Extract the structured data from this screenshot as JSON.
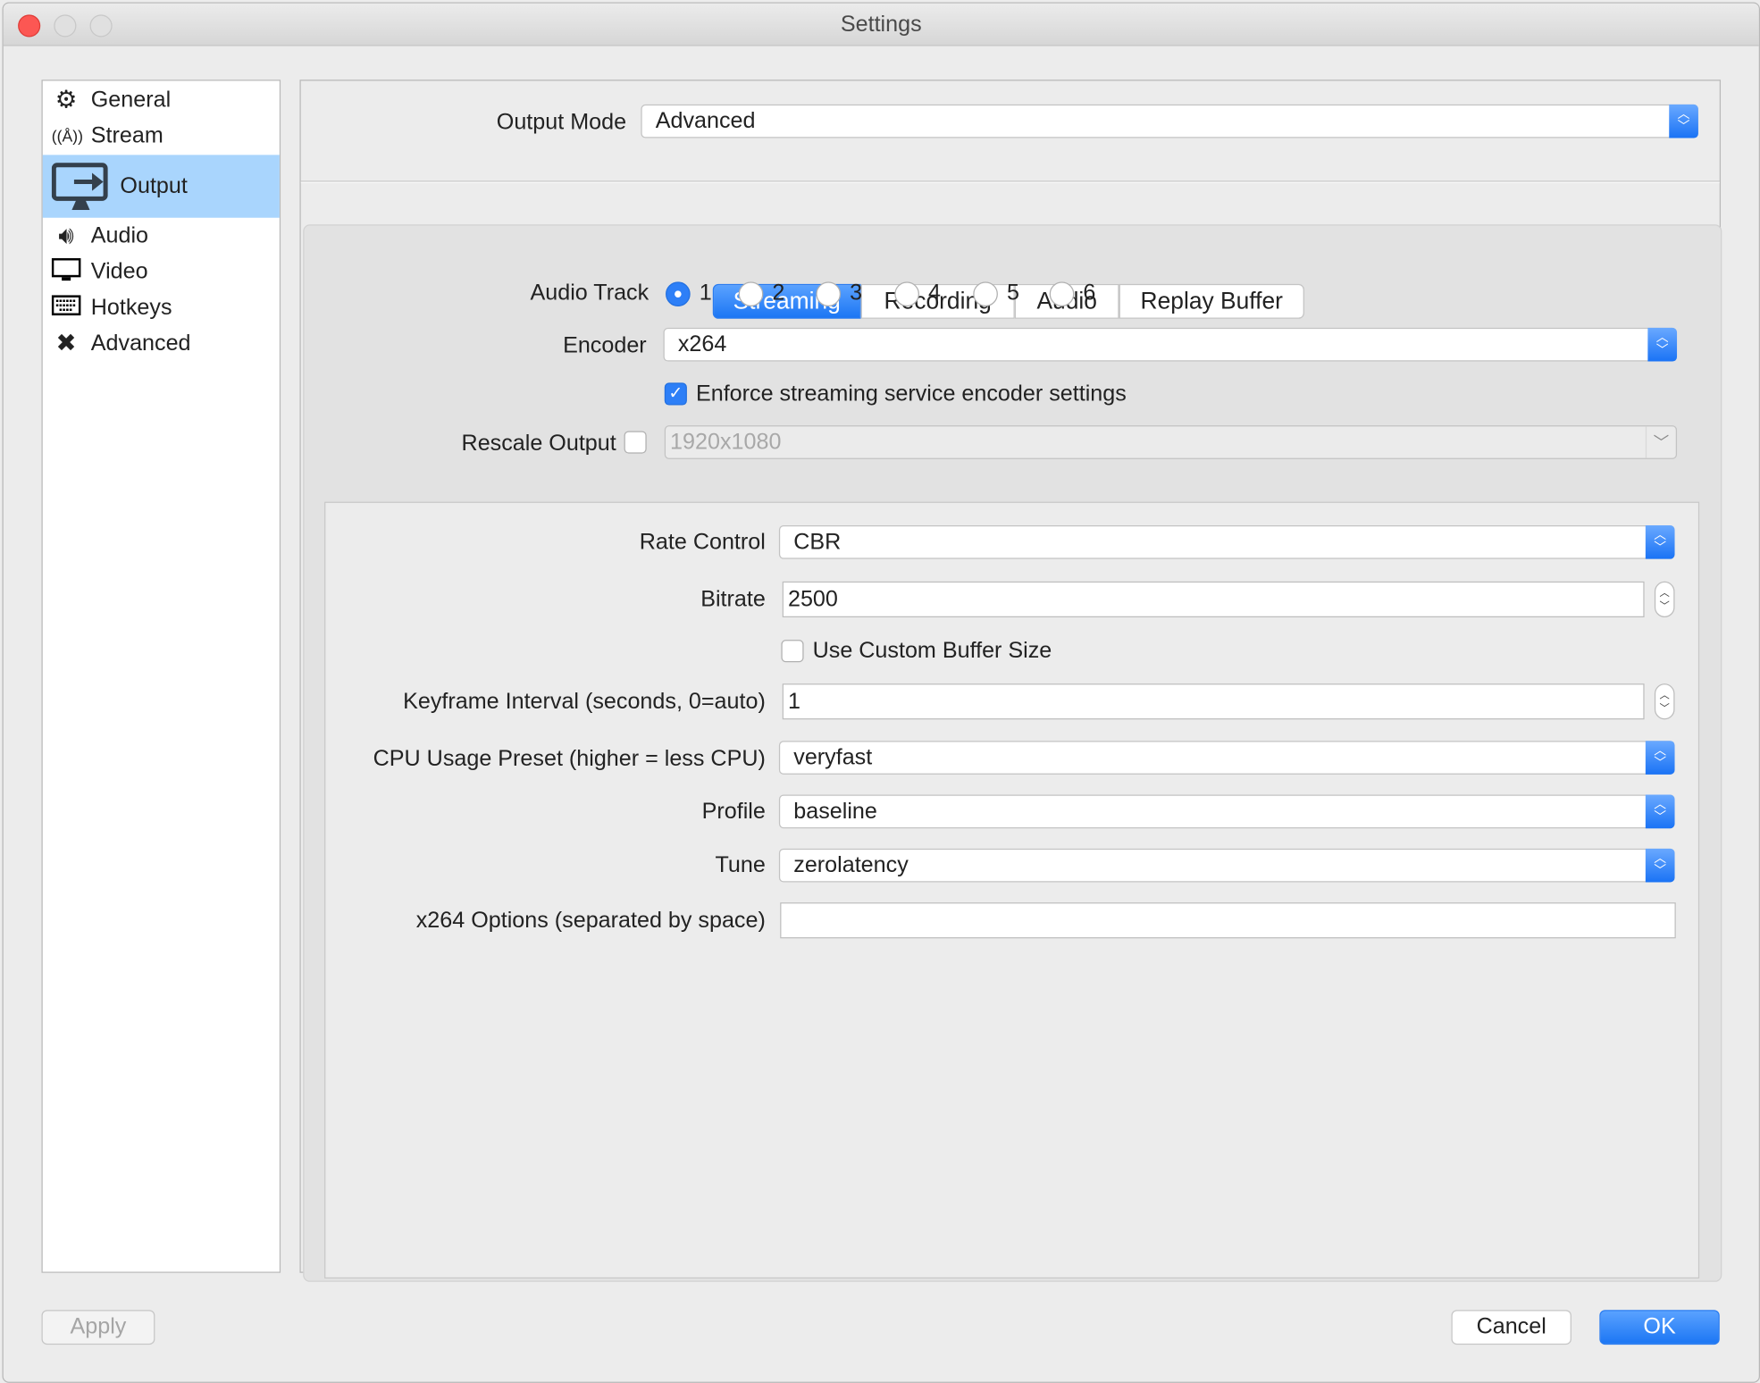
{
  "window": {
    "title": "Settings"
  },
  "sidebar": {
    "items": [
      {
        "label": "General",
        "icon": "gear-icon"
      },
      {
        "label": "Stream",
        "icon": "antenna-icon"
      },
      {
        "label": "Output",
        "icon": "monitor-output-icon",
        "selected": true
      },
      {
        "label": "Audio",
        "icon": "speaker-icon"
      },
      {
        "label": "Video",
        "icon": "monitor-icon"
      },
      {
        "label": "Hotkeys",
        "icon": "keyboard-icon"
      },
      {
        "label": "Advanced",
        "icon": "tools-icon"
      }
    ]
  },
  "output_mode": {
    "label": "Output Mode",
    "value": "Advanced"
  },
  "tabs": [
    {
      "label": "Streaming",
      "active": true
    },
    {
      "label": "Recording"
    },
    {
      "label": "Audio"
    },
    {
      "label": "Replay Buffer"
    }
  ],
  "streaming": {
    "audio_track": {
      "label": "Audio Track",
      "options": [
        "1",
        "2",
        "3",
        "4",
        "5",
        "6"
      ],
      "selected": "1"
    },
    "encoder": {
      "label": "Encoder",
      "value": "x264"
    },
    "enforce": {
      "label": "Enforce streaming service encoder settings",
      "checked": true
    },
    "rescale": {
      "label": "Rescale Output",
      "checked": false,
      "value": "1920x1080"
    },
    "rate_control": {
      "label": "Rate Control",
      "value": "CBR"
    },
    "bitrate": {
      "label": "Bitrate",
      "value": "2500"
    },
    "custom_buffer": {
      "label": "Use Custom Buffer Size",
      "checked": false
    },
    "keyframe": {
      "label": "Keyframe Interval (seconds, 0=auto)",
      "value": "1"
    },
    "cpu_preset": {
      "label": "CPU Usage Preset (higher = less CPU)",
      "value": "veryfast"
    },
    "profile": {
      "label": "Profile",
      "value": "baseline"
    },
    "tune": {
      "label": "Tune",
      "value": "zerolatency"
    },
    "x264_options": {
      "label": "x264 Options (separated by space)",
      "value": ""
    }
  },
  "buttons": {
    "apply": "Apply",
    "cancel": "Cancel",
    "ok": "OK"
  },
  "colors": {
    "accent": "#1c76f4",
    "selection": "#a9d5fd",
    "close": "#fc5753"
  }
}
